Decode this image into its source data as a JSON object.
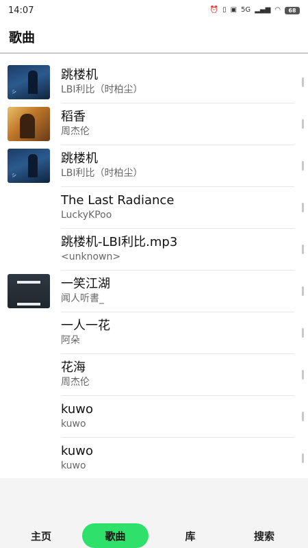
{
  "status_bar": {
    "time": "14:07",
    "network": "5G",
    "battery": "68"
  },
  "header": {
    "title": "歌曲"
  },
  "songs": [
    {
      "title": "跳楼机",
      "artist": "LBI利比（时柏尘）",
      "cover": "cover-1"
    },
    {
      "title": "稻香",
      "artist": "周杰伦",
      "cover": "cover-2"
    },
    {
      "title": "跳楼机",
      "artist": "LBI利比（时柏尘）",
      "cover": "cover-1"
    },
    {
      "title": "The Last Radiance",
      "artist": "LuckyKPoo",
      "cover": ""
    },
    {
      "title": "跳楼机-LBI利比.mp3",
      "artist": "<unknown>",
      "cover": ""
    },
    {
      "title": "一笑江湖",
      "artist": "闻人听書_",
      "cover": "cover-3"
    },
    {
      "title": "一人一花",
      "artist": "阿朵",
      "cover": ""
    },
    {
      "title": "花海",
      "artist": "周杰伦",
      "cover": ""
    },
    {
      "title": "kuwo",
      "artist": "kuwo",
      "cover": ""
    },
    {
      "title": "kuwo",
      "artist": "kuwo",
      "cover": ""
    }
  ],
  "bottom_nav": {
    "home": "主页",
    "songs": "歌曲",
    "library": "库",
    "search": "搜索"
  },
  "colors": {
    "active_tab": "#2fe06a",
    "nav_background": "#f4f4f4"
  }
}
